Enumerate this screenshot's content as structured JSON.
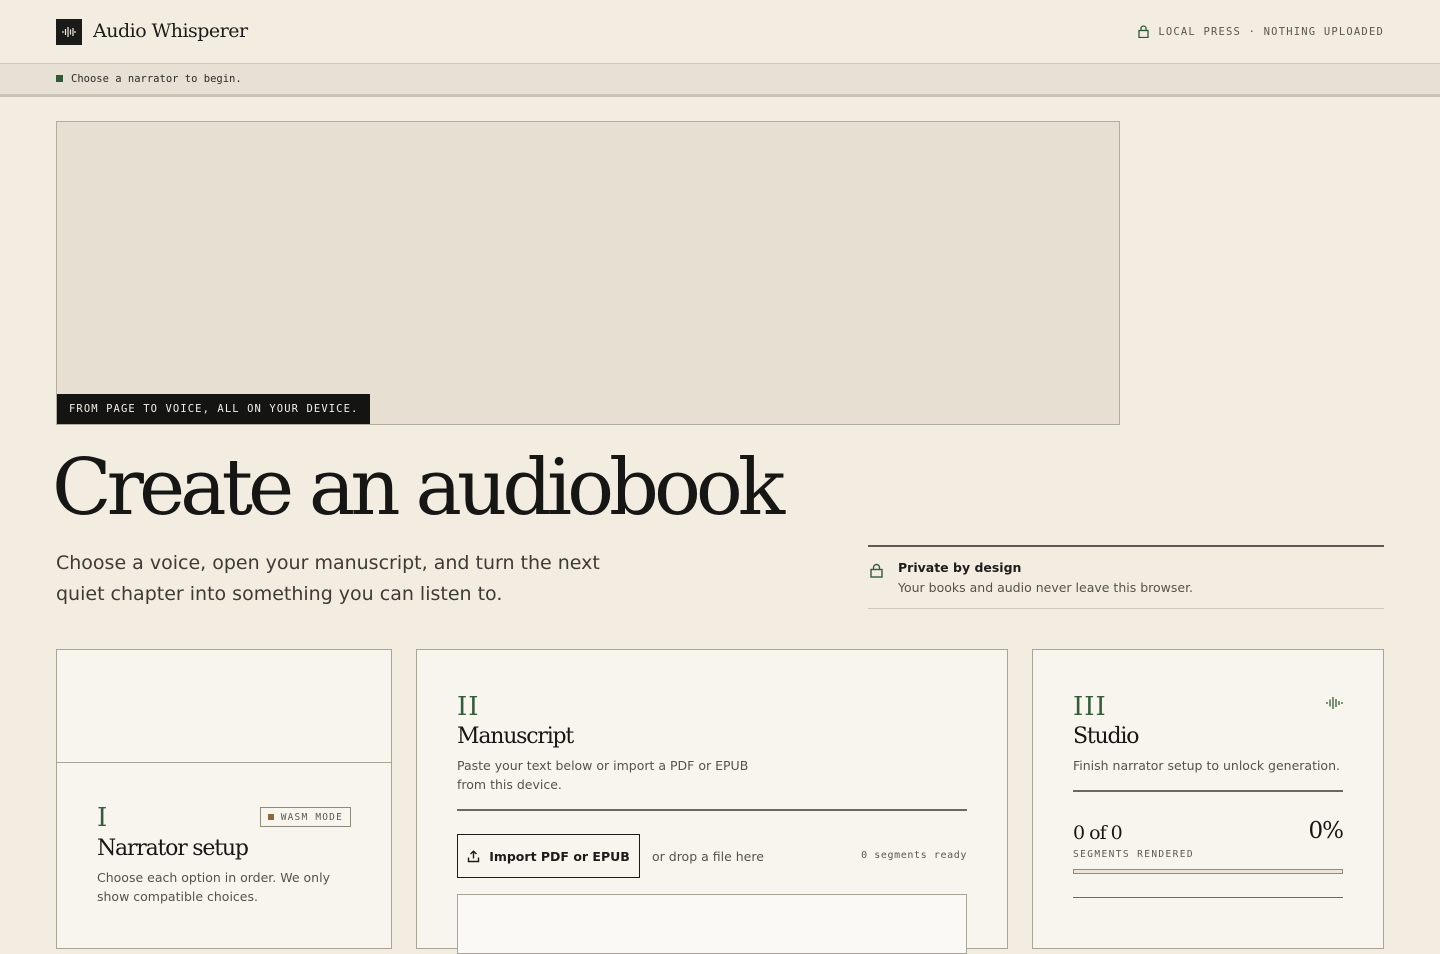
{
  "header": {
    "brand": "Audio Whisperer",
    "privacy_status": "LOCAL PRESS · NOTHING UPLOADED"
  },
  "status": {
    "message": "Choose a narrator to begin."
  },
  "hero": {
    "caption": "FROM PAGE TO VOICE, ALL ON YOUR DEVICE.",
    "title": "Create an audiobook",
    "subtitle": "Choose a voice, open your manuscript, and turn the next quiet chapter into something you can listen to."
  },
  "privacy": {
    "title": "Private by design",
    "text": "Your books and audio never leave this browser."
  },
  "cards": {
    "narrator": {
      "numeral": "I",
      "badge": "WASM MODE",
      "title": "Narrator setup",
      "description": "Choose each option in order. We only show compatible choices."
    },
    "manuscript": {
      "numeral": "II",
      "title": "Manuscript",
      "description": "Paste your text below or import a PDF or EPUB from this device.",
      "import_label": "Import PDF or EPUB",
      "drop_hint": "or drop a file here",
      "segments_ready": "0 segments ready"
    },
    "studio": {
      "numeral": "III",
      "title": "Studio",
      "description": "Finish narrator setup to unlock generation.",
      "count": "0 of 0",
      "percent": "0%",
      "count_label": "SEGMENTS RENDERED",
      "progress_fraction": 0
    }
  },
  "colors": {
    "accent_green": "#365c3b",
    "ink": "#161614",
    "paper": "#f2ece1"
  },
  "icons": {
    "logo": "waveform-icon",
    "lock": "lock-icon",
    "upload": "upload-icon",
    "studio": "waveform-icon"
  }
}
